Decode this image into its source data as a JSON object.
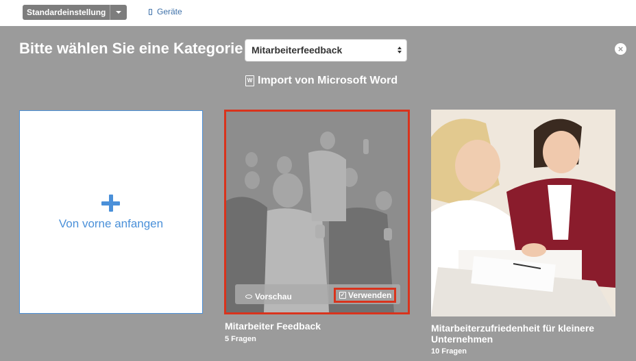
{
  "toolbar": {
    "preset_label": "Standardeinstellung",
    "devices_label": "Geräte"
  },
  "header": {
    "title": "Bitte wählen Sie eine Kategorie",
    "category_value": "Mitarbeiterfeedback",
    "import_label": "Import von Microsoft Word"
  },
  "cards": {
    "new": {
      "label": "Von vorne anfangen"
    },
    "template1": {
      "title": "Mitarbeiter Feedback",
      "subtitle": "5 Fragen",
      "preview_label": "Vorschau",
      "use_label": "Verwenden"
    },
    "template2": {
      "title_line1": "Mitarbeiterzufriedenheit für kleinere",
      "title_line2": "Unternehmen",
      "subtitle": "10 Fragen"
    }
  },
  "colors": {
    "accent": "#4a90d9",
    "highlight": "#d9331c",
    "backdrop": "#9b9b9b"
  }
}
